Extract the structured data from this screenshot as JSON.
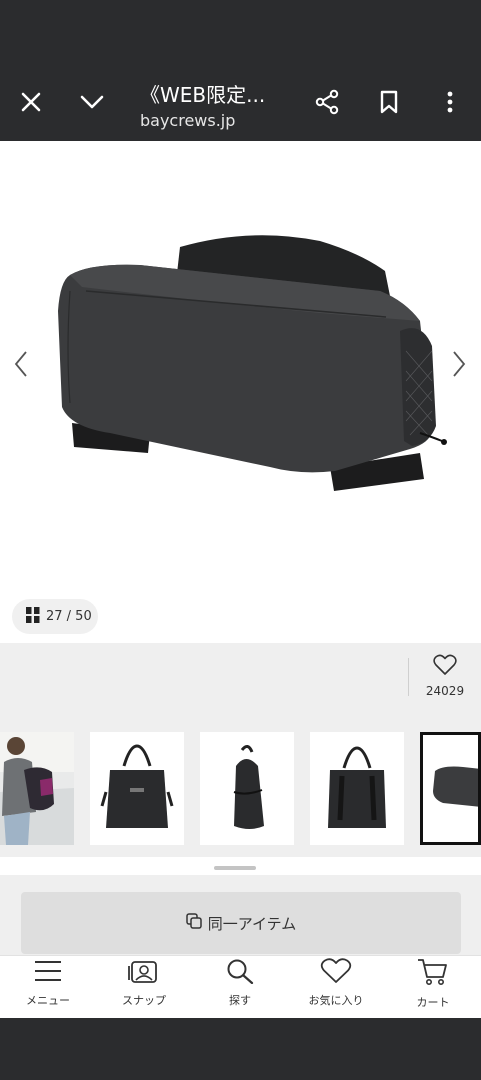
{
  "browser": {
    "title": "《WEB限定...",
    "domain": "baycrews.jp",
    "icons": [
      "close-icon",
      "chevron-down-icon",
      "share-icon",
      "bookmark-icon",
      "more-vert-icon"
    ]
  },
  "gallery": {
    "counter": "27 / 50",
    "prev_icon": "chevron-left-icon",
    "next_icon": "chevron-right-icon"
  },
  "favorite": {
    "count": "24029",
    "icon": "heart-icon"
  },
  "thumbnails": [
    {
      "name": "thumb-model-wearing-bag"
    },
    {
      "name": "thumb-tote-front"
    },
    {
      "name": "thumb-tote-side"
    },
    {
      "name": "thumb-tote-back"
    },
    {
      "name": "thumb-bag-bottom"
    }
  ],
  "same_item_button": {
    "label": "同一アイテム"
  },
  "bottom_nav": [
    {
      "label": "メニュー",
      "icon": "menu-icon"
    },
    {
      "label": "スナップ",
      "icon": "snap-icon"
    },
    {
      "label": "探す",
      "icon": "search-icon"
    },
    {
      "label": "お気に入り",
      "icon": "heart-icon"
    },
    {
      "label": "カート",
      "icon": "cart-icon"
    }
  ],
  "colors": {
    "chrome": "#2b2c2e",
    "panel": "#efefef",
    "selected_border": "#111111"
  }
}
